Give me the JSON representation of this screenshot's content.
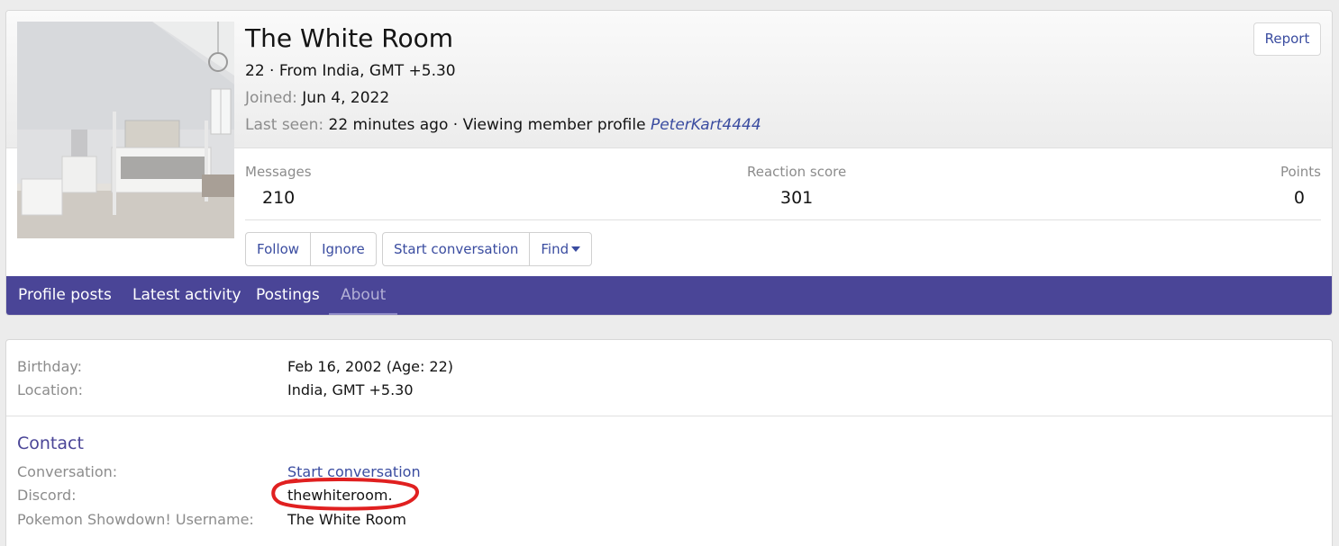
{
  "profile": {
    "name": "The White Room",
    "age_location": "22 · From India, GMT +5.30",
    "joined_label": "Joined:",
    "joined_value": "Jun 4, 2022",
    "last_seen_label": "Last seen:",
    "last_seen_value": "22 minutes ago · Viewing member profile",
    "last_seen_link": "PeterKart4444",
    "report_label": "Report"
  },
  "stats": [
    {
      "label": "Messages",
      "value": "210"
    },
    {
      "label": "Reaction score",
      "value": "301"
    },
    {
      "label": "Points",
      "value": "0"
    }
  ],
  "actions": {
    "follow": "Follow",
    "ignore": "Ignore",
    "start_conversation": "Start conversation",
    "find": "Find"
  },
  "tabs": [
    {
      "label": "Profile posts",
      "active": false
    },
    {
      "label": "Latest activity",
      "active": false
    },
    {
      "label": "Postings",
      "active": false
    },
    {
      "label": "About",
      "active": true
    }
  ],
  "about": {
    "rows": [
      {
        "label": "Birthday:",
        "value": "Feb 16, 2002 (Age: 22)"
      },
      {
        "label": "Location:",
        "value": "India, GMT +5.30"
      }
    ],
    "contact_heading": "Contact",
    "contact_rows": [
      {
        "label": "Conversation:",
        "value": "Start conversation"
      },
      {
        "label": "Discord:",
        "value": "thewhiteroom."
      },
      {
        "label": "Pokemon Showdown! Username:",
        "value": "The White Room"
      }
    ]
  },
  "colors": {
    "accent": "#4a4597",
    "link": "#3a4ca0",
    "annotation": "#e02020"
  },
  "icons": [
    "chevron-down-icon"
  ]
}
